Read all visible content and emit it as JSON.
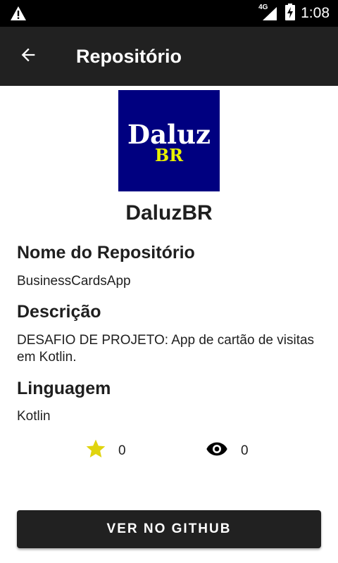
{
  "status_bar": {
    "network": "4G",
    "time": "1:08",
    "icons": [
      "warning-icon",
      "signal-icon",
      "battery-charging-icon"
    ]
  },
  "app_bar": {
    "back_icon": "arrow-back-icon",
    "title": "Repositório"
  },
  "owner": {
    "logo_text_top": "Daluz",
    "logo_text_bottom": "BR",
    "name": "DaluzBR"
  },
  "repository": {
    "name_label": "Nome do Repositório",
    "name": "BusinessCardsApp",
    "description_label": "Descrição",
    "description": "DESAFIO DE PROJETO: App de cartão de visitas em Kotlin.",
    "language_label": "Linguagem",
    "language": "Kotlin",
    "stars": "0",
    "watchers": "0"
  },
  "actions": {
    "github_button": "VER NO GITHUB"
  },
  "colors": {
    "status_bar": "#000000",
    "app_bar": "#212121",
    "logo_bg": "#000080",
    "star": "#e0d40e",
    "button": "#212121"
  }
}
